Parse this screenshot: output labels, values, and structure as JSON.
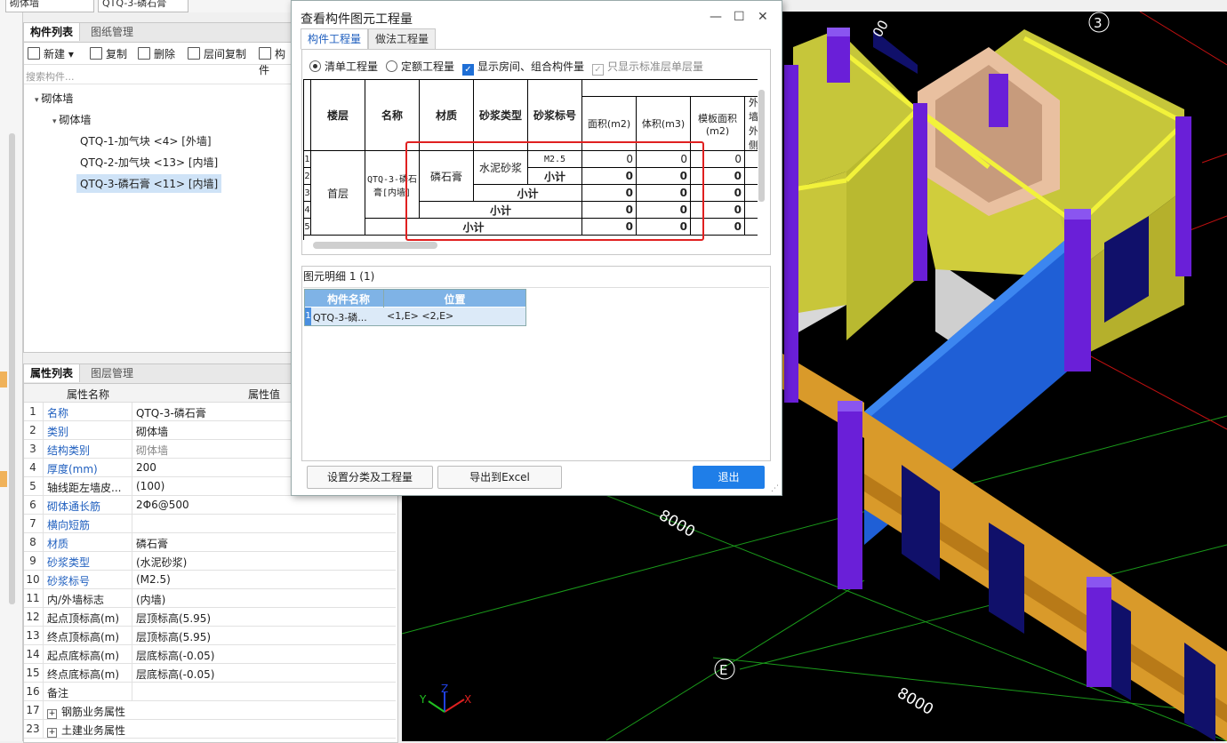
{
  "top_combos": {
    "left": "砌体墙",
    "right": "QTQ-3-磷石膏"
  },
  "component_panel": {
    "tabs": [
      "构件列表",
      "图纸管理"
    ],
    "toolbar": {
      "new": "新建",
      "copy": "复制",
      "delete": "删除",
      "floor_copy": "层间复制",
      "more": "构件"
    },
    "search_placeholder": "搜索构件...",
    "tree": {
      "root": "砌体墙",
      "child": "砌体墙",
      "items": [
        "QTQ-1-加气块 <4> [外墙]",
        "QTQ-2-加气块 <13> [内墙]",
        "QTQ-3-磷石膏 <11> [内墙]"
      ]
    }
  },
  "property_panel": {
    "tabs": [
      "属性列表",
      "图层管理"
    ],
    "headers": {
      "name": "属性名称",
      "value": "属性值"
    },
    "rows": [
      {
        "n": "1",
        "name": "名称",
        "value": "QTQ-3-磷石膏"
      },
      {
        "n": "2",
        "name": "类别",
        "value": "砌体墙"
      },
      {
        "n": "3",
        "name": "结构类别",
        "value": "砌体墙"
      },
      {
        "n": "4",
        "name": "厚度(mm)",
        "value": "200"
      },
      {
        "n": "5",
        "name": "轴线距左墙皮...",
        "value": "(100)"
      },
      {
        "n": "6",
        "name": "砌体通长筋",
        "value": "2Φ6@500"
      },
      {
        "n": "7",
        "name": "横向短筋",
        "value": ""
      },
      {
        "n": "8",
        "name": "材质",
        "value": "磷石膏"
      },
      {
        "n": "9",
        "name": "砂浆类型",
        "value": "(水泥砂浆)"
      },
      {
        "n": "10",
        "name": "砂浆标号",
        "value": "(M2.5)"
      },
      {
        "n": "11",
        "name": "内/外墙标志",
        "value": "(内墙)"
      },
      {
        "n": "12",
        "name": "起点顶标高(m)",
        "value": "层顶标高(5.95)"
      },
      {
        "n": "13",
        "name": "终点顶标高(m)",
        "value": "层顶标高(5.95)"
      },
      {
        "n": "14",
        "name": "起点底标高(m)",
        "value": "层底标高(-0.05)"
      },
      {
        "n": "15",
        "name": "终点底标高(m)",
        "value": "层底标高(-0.05)"
      },
      {
        "n": "16",
        "name": "备注",
        "value": ""
      },
      {
        "n": "17",
        "name": "钢筋业务属性",
        "value": ""
      },
      {
        "n": "23",
        "name": "土建业务属性",
        "value": ""
      }
    ]
  },
  "dialog": {
    "title": "查看构件图元工程量",
    "tabs": [
      "构件工程量",
      "做法工程量"
    ],
    "options": {
      "qingdan": "清单工程量",
      "dinge": "定额工程量",
      "show_rooms": "显示房间、组合构件量",
      "std_floor": "只显示标准层单层量"
    },
    "table": {
      "headers": [
        "楼层",
        "名称",
        "材质",
        "砂浆类型",
        "砂浆标号",
        "面积(m2)",
        "体积(m3)",
        "模板面积(m2)",
        "外墙外侧"
      ],
      "row_nums": [
        "1",
        "2",
        "3",
        "4",
        "5"
      ],
      "floor": "首层",
      "name": "QTQ-3-磷石膏[内墙]",
      "material": "磷石膏",
      "mortar_type": "水泥砂浆",
      "mortar_grade": "M2.5",
      "subtotal": "小计",
      "zero": "0"
    },
    "detail": {
      "label": "图元明细",
      "count": "1 (1)",
      "headers": [
        "构件名称",
        "位置"
      ],
      "row": {
        "n": "1",
        "name": "QTQ-3-磷...",
        "position": "<1,E> <2,E>"
      }
    },
    "buttons": {
      "settings": "设置分类及工程量",
      "export": "导出到Excel",
      "exit": "退出"
    }
  },
  "view3d": {
    "labels": {
      "dim1": "8000",
      "dim2": "8000",
      "axis_e": "E",
      "axis_3": "3",
      "top_dim": "00"
    },
    "axes": {
      "x": "X",
      "y": "Y",
      "z": "Z"
    }
  },
  "colors": {
    "accent": "#1f7ee8",
    "highlight_red": "#e02020",
    "wall_yellow": "#c6c63a",
    "column_purple": "#6a1fd8",
    "wall_blue": "#1f5fd6",
    "wall_orange": "#d99a2a"
  }
}
